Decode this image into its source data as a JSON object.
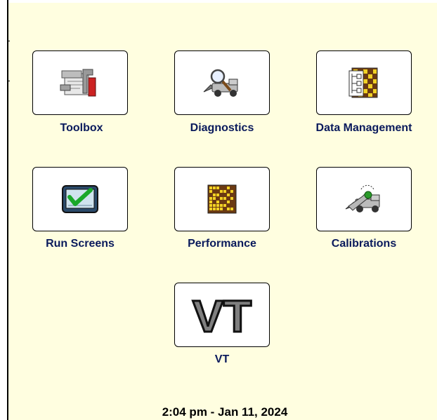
{
  "menu": {
    "toolbox": {
      "label": "Toolbox",
      "icon": "toolbox-icon"
    },
    "diagnostics": {
      "label": "Diagnostics",
      "icon": "diagnostics-icon"
    },
    "data_management": {
      "label": "Data Management",
      "icon": "data-management-icon"
    },
    "run_screens": {
      "label": "Run Screens",
      "icon": "run-screens-icon"
    },
    "performance": {
      "label": "Performance",
      "icon": "performance-icon"
    },
    "calibrations": {
      "label": "Calibrations",
      "icon": "calibrations-icon"
    },
    "vt": {
      "label": "VT",
      "icon": "vt-icon",
      "icon_text": "VT"
    }
  },
  "status": {
    "datetime": "2:04 pm - Jan 11, 2024"
  },
  "colors": {
    "background": "#fffee0",
    "label": "#0a1a5c"
  }
}
